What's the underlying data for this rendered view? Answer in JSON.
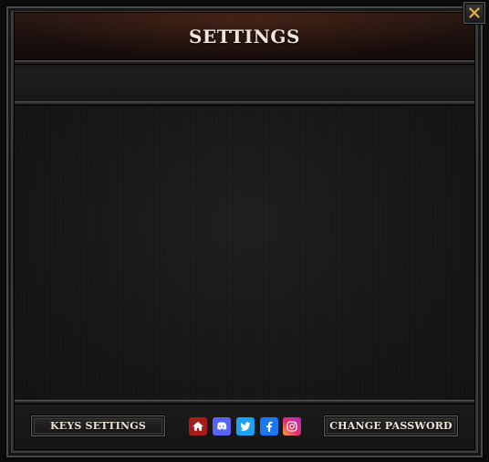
{
  "window": {
    "title": "SETTINGS"
  },
  "footer": {
    "keys_settings_label": "KEYS SETTINGS",
    "change_password_label": "CHANGE PASSWORD",
    "social": [
      {
        "name": "home-icon",
        "color": "#a61c1c"
      },
      {
        "name": "discord-icon",
        "color": "#5865f2"
      },
      {
        "name": "twitter-icon",
        "color": "#1da1f2"
      },
      {
        "name": "facebook-icon",
        "color": "#1877f2"
      },
      {
        "name": "instagram-icon",
        "color": "#e1306c"
      }
    ]
  },
  "close": {
    "icon": "close-icon",
    "color": "#e0b23a"
  }
}
